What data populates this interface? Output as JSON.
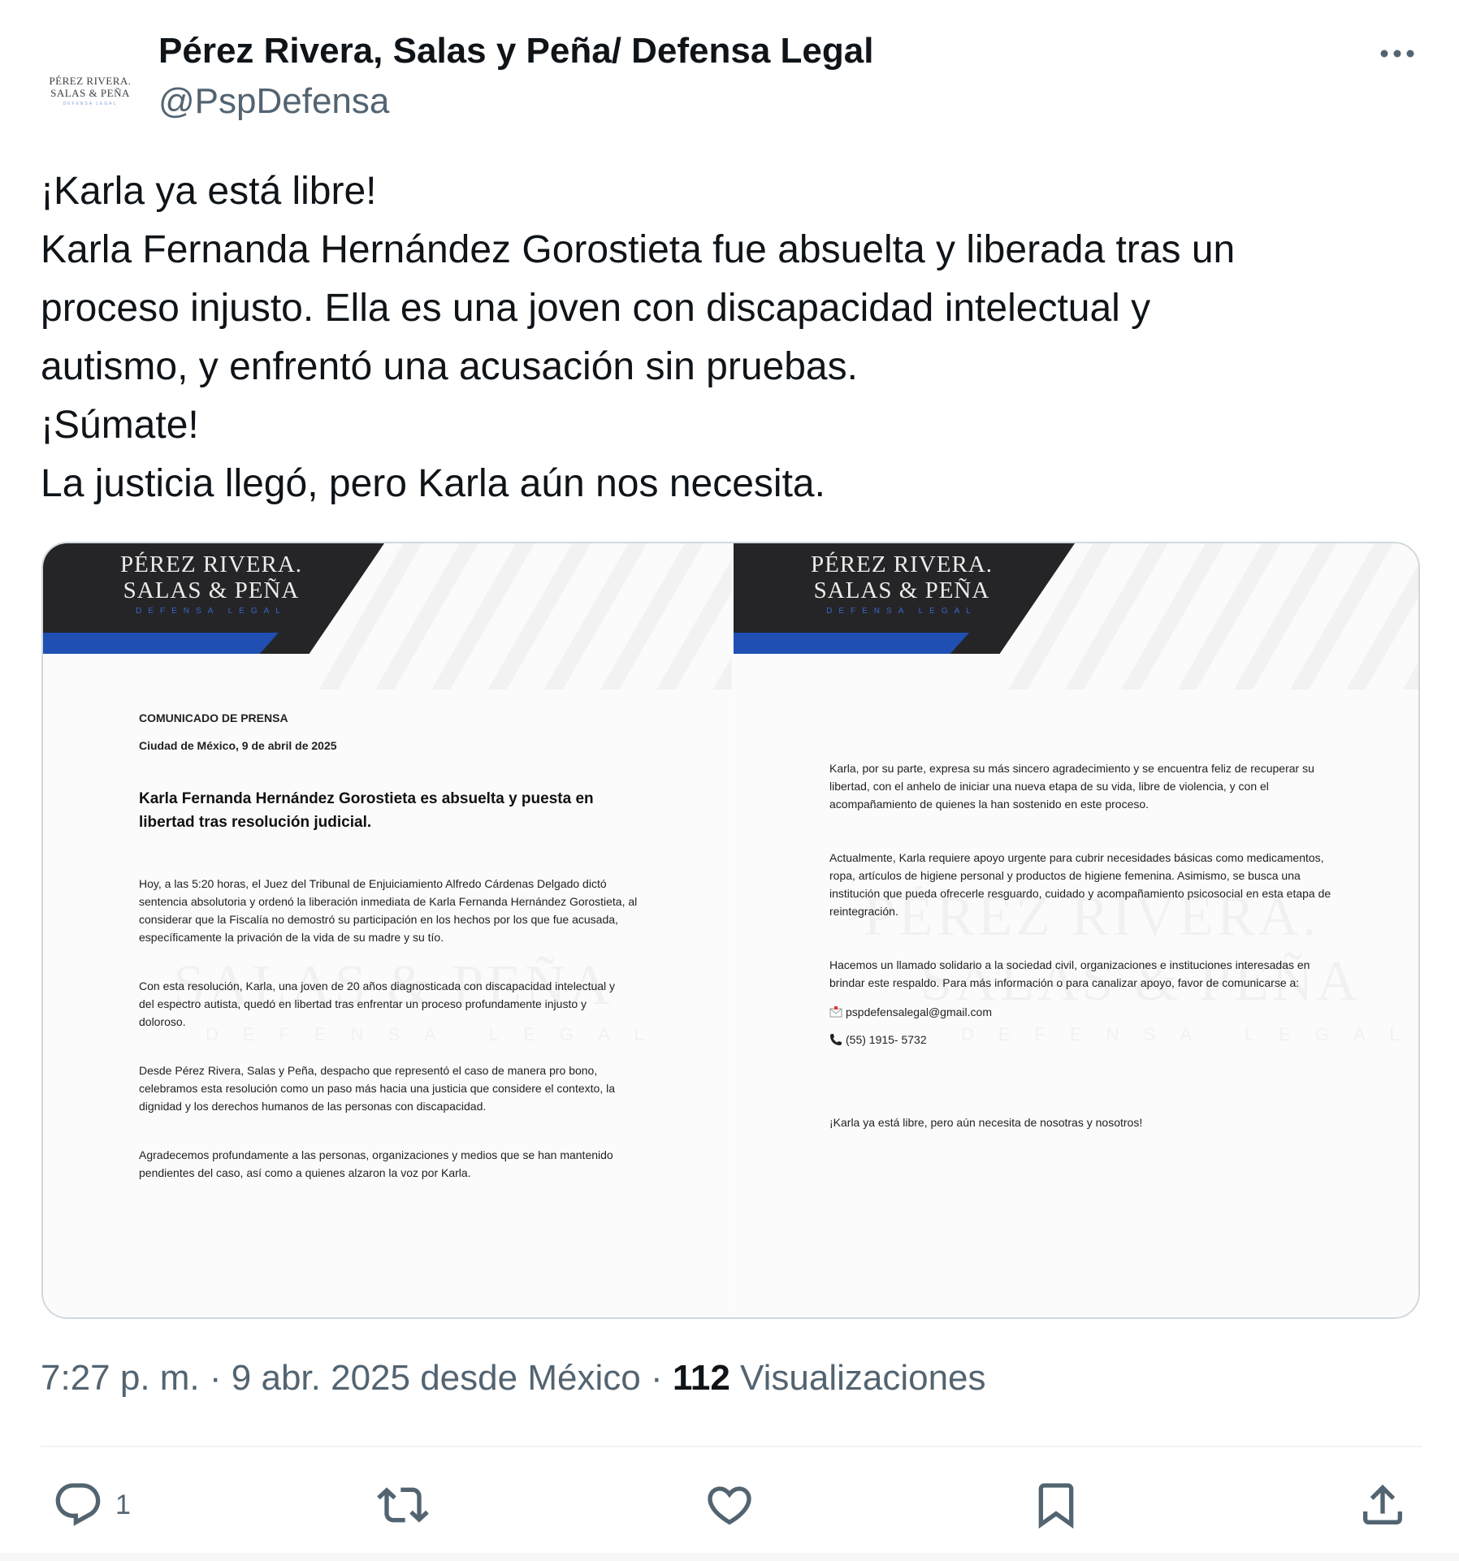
{
  "author": {
    "display_name": "Pérez Rivera, Salas y Peña/ Defensa Legal",
    "handle": "@PspDefensa",
    "avatar": {
      "line1": "PÉREZ RIVERA.",
      "line2": "SALAS & PEÑA",
      "line3": "DEFENSA LEGAL"
    }
  },
  "tweet": {
    "lines": [
      "¡Karla ya está libre!",
      "Karla Fernanda Hernández Gorostieta fue absuelta y liberada tras un",
      "proceso injusto. Ella es una joven con discapacidad intelectual y",
      "autismo, y enfrentó una acusación sin pruebas.",
      "¡Súmate!",
      "La justicia llegó, pero Karla aún nos necesita."
    ]
  },
  "media": {
    "brand": {
      "line1": "PÉREZ RIVERA.",
      "line2": "SALAS & PEÑA",
      "sub": "DEFENSA LEGAL"
    },
    "watermark": {
      "left_line": "SALAS & PEÑA",
      "left_sub": "DEFENSA LEGAL",
      "right_line1": "PÉREZ RIVERA.",
      "right_line2": "SALAS & PEÑA",
      "right_sub": "DEFENSA LEGAL"
    },
    "page1": {
      "label": "COMUNICADO DE PRENSA",
      "date": "Ciudad de México, 9 de abril de 2025",
      "headline": "Karla Fernanda Hernández Gorostieta es absuelta y puesta en libertad tras resolución judicial.",
      "p1": "Hoy, a las 5:20 horas, el Juez del Tribunal de Enjuiciamiento Alfredo Cárdenas Delgado dictó sentencia absolutoria y ordenó la liberación inmediata de Karla Fernanda Hernández Gorostieta, al considerar que la Fiscalía no demostró su participación en los hechos por los que fue acusada, específicamente la privación de la vida de su madre y su tío.",
      "p2": "Con esta resolución, Karla, una joven de 20 años diagnosticada con discapacidad intelectual y del espectro autista, quedó en libertad tras enfrentar un proceso profundamente injusto y doloroso.",
      "p3": "Desde Pérez Rivera, Salas y Peña, despacho que representó el caso de manera pro bono, celebramos esta resolución como un paso más hacia una justicia que considere el contexto, la dignidad y los derechos humanos de las personas con discapacidad.",
      "p4": "Agradecemos profundamente a las personas, organizaciones y medios que se han mantenido pendientes del caso, así como a quienes alzaron la voz por Karla."
    },
    "page2": {
      "p1": "Karla, por su parte, expresa su más sincero agradecimiento y se encuentra feliz de recuperar su libertad, con el anhelo de iniciar una nueva etapa de su vida, libre de violencia, y con el acompañamiento de quienes la han sostenido en este proceso.",
      "p2": "Actualmente, Karla requiere apoyo urgente para cubrir necesidades básicas como medicamentos, ropa, artículos de higiene personal y productos de higiene femenina. Asimismo, se busca una institución que pueda ofrecerle resguardo, cuidado y acompañamiento psicosocial en esta etapa de reintegración.",
      "p3": "Hacemos un llamado solidario a la sociedad civil, organizaciones e instituciones interesadas en brindar este respaldo. Para más información o para canalizar apoyo, favor de comunicarse a:",
      "email": "pspdefensalegal@gmail.com",
      "phone": "(55) 1915- 5732",
      "closing": "¡Karla ya está libre, pero aún necesita de nosotras y nosotros!"
    }
  },
  "meta": {
    "time": "7:27 p. m.",
    "separator": "·",
    "date": "9 abr. 2025 desde México",
    "views_count": "112",
    "views_label": "Visualizaciones"
  },
  "actions": {
    "reply_count": "1"
  },
  "colors": {
    "text_primary": "#0f1419",
    "text_secondary": "#536471",
    "border": "#cfd9de",
    "brand_dark": "#252527",
    "brand_blue": "#1f4fb2"
  }
}
